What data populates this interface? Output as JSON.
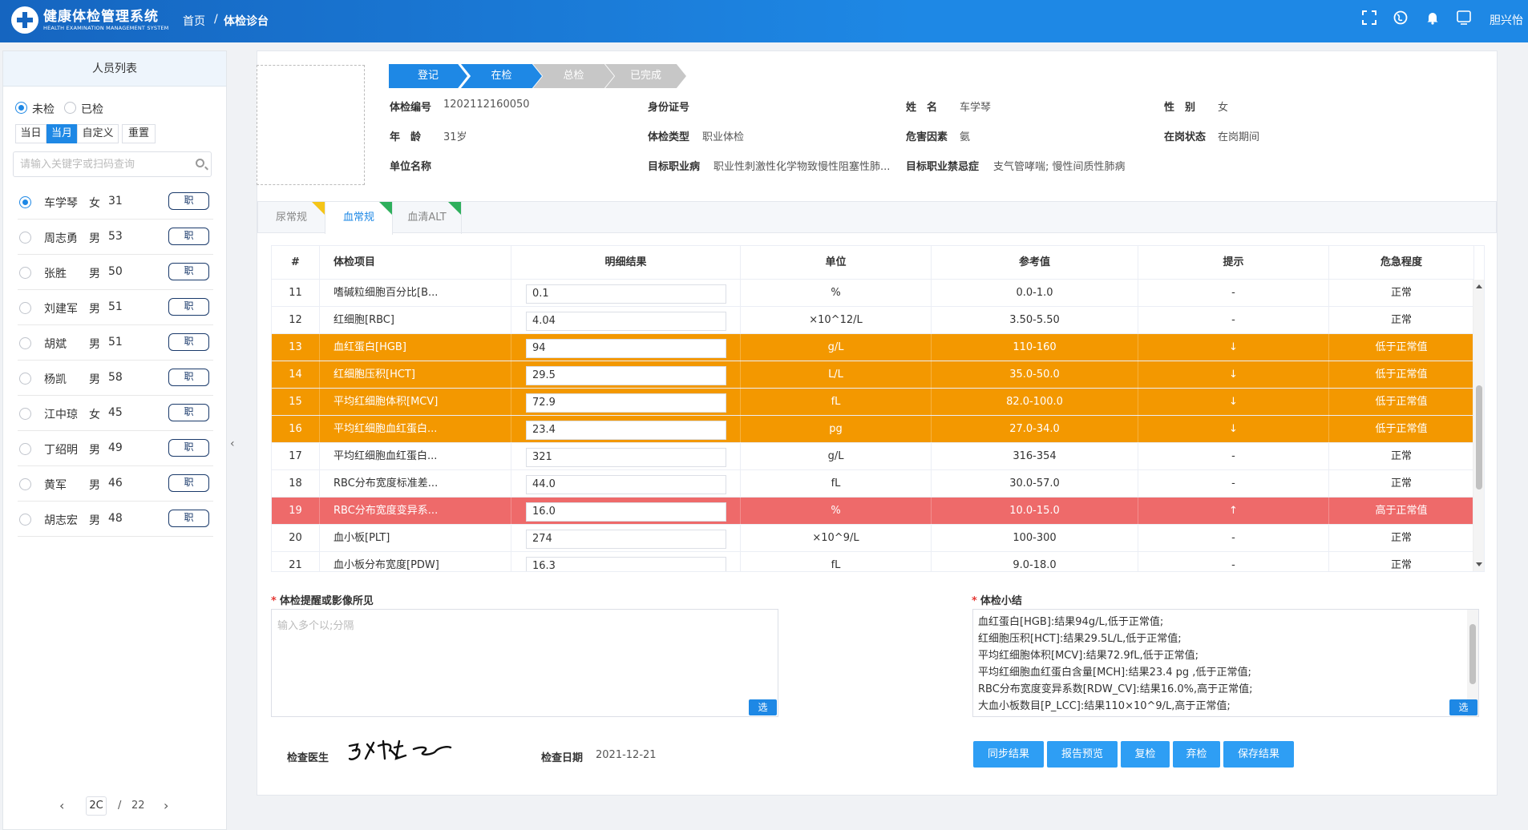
{
  "header": {
    "app_title": "健康体检管理系统",
    "app_subtitle": "HEALTH EXAMINATION MANAGEMENT SYSTEM",
    "breadcrumb": [
      "首页",
      "/",
      "体检诊台"
    ],
    "icons": [
      "fullscreen-icon",
      "globe-icon",
      "bell-icon",
      "monitor-icon"
    ],
    "username": "胆兴怡"
  },
  "left": {
    "title": "人员列表",
    "status_options": [
      {
        "label": "未检",
        "selected": true
      },
      {
        "label": "已检",
        "selected": false
      }
    ],
    "date_filters": [
      {
        "label": "当日",
        "active": false
      },
      {
        "label": "当月",
        "active": true
      },
      {
        "label": "自定义",
        "active": false
      },
      {
        "label": "重置",
        "active": false
      }
    ],
    "search_placeholder": "请输入关键字或扫码查询",
    "people": [
      {
        "name": "车学琴",
        "sex": "女",
        "age": "31",
        "tag": "职",
        "selected": true
      },
      {
        "name": "周志勇",
        "sex": "男",
        "age": "53",
        "tag": "职",
        "selected": false
      },
      {
        "name": "张胜",
        "sex": "男",
        "age": "50",
        "tag": "职",
        "selected": false
      },
      {
        "name": "刘建军",
        "sex": "男",
        "age": "51",
        "tag": "职",
        "selected": false
      },
      {
        "name": "胡斌",
        "sex": "男",
        "age": "51",
        "tag": "职",
        "selected": false
      },
      {
        "name": "杨凯",
        "sex": "男",
        "age": "58",
        "tag": "职",
        "selected": false
      },
      {
        "name": "江中琼",
        "sex": "女",
        "age": "45",
        "tag": "职",
        "selected": false
      },
      {
        "name": "丁绍明",
        "sex": "男",
        "age": "49",
        "tag": "职",
        "selected": false
      },
      {
        "name": "黄军",
        "sex": "男",
        "age": "46",
        "tag": "职",
        "selected": false
      },
      {
        "name": "胡志宏",
        "sex": "男",
        "age": "48",
        "tag": "职",
        "selected": false
      }
    ],
    "pager": {
      "prev": "‹",
      "current": "2C",
      "separator": "/",
      "total": "22",
      "next": "›"
    },
    "collapse": "‹"
  },
  "steps": [
    {
      "label": "登记",
      "done": true
    },
    {
      "label": "在检",
      "done": true
    },
    {
      "label": "总检",
      "done": false
    },
    {
      "label": "已完成",
      "done": false
    }
  ],
  "info": {
    "exam_no_label": "体检编号",
    "exam_no": "1202112160050",
    "id_label": "身份证号",
    "id": "",
    "name_label": "姓　名",
    "name": "车学琴",
    "sex_label": "性　别",
    "sex": "女",
    "age_label": "年　龄",
    "age": "31岁",
    "type_label": "体检类型",
    "type": "职业体检",
    "hazard_label": "危害因素",
    "hazard": "氨",
    "post_label": "在岗状态",
    "post": "在岗期间",
    "unit_label": "单位名称",
    "unit": "",
    "target_disease_label": "目标职业病",
    "target_disease": "职业性刺激性化学物致慢性阻塞性肺...",
    "taboo_label": "目标职业禁忌症",
    "taboo": "支气管哮喘; 慢性间质性肺病"
  },
  "tabs": [
    {
      "label": "尿常规",
      "active": false,
      "corner": "yellow"
    },
    {
      "label": "血常规",
      "active": true,
      "corner": "green"
    },
    {
      "label": "血清ALT",
      "active": false,
      "corner": "green"
    }
  ],
  "table": {
    "headers": [
      "#",
      "体检项目",
      "明细结果",
      "单位",
      "参考值",
      "提示",
      "危急程度"
    ],
    "rows": [
      {
        "no": "11",
        "item": "嗜碱粒细胞百分比[B...",
        "result": "0.1",
        "unit": "%",
        "ref": "0.0-1.0",
        "hint": "-",
        "level": "正常",
        "status": "normal"
      },
      {
        "no": "12",
        "item": "红细胞[RBC]",
        "result": "4.04",
        "unit": "×10^12/L",
        "ref": "3.50-5.50",
        "hint": "-",
        "level": "正常",
        "status": "normal"
      },
      {
        "no": "13",
        "item": "血红蛋白[HGB]",
        "result": "94",
        "unit": "g/L",
        "ref": "110-160",
        "hint": "↓",
        "level": "低于正常值",
        "status": "low"
      },
      {
        "no": "14",
        "item": "红细胞压积[HCT]",
        "result": "29.5",
        "unit": "L/L",
        "ref": "35.0-50.0",
        "hint": "↓",
        "level": "低于正常值",
        "status": "low"
      },
      {
        "no": "15",
        "item": "平均红细胞体积[MCV]",
        "result": "72.9",
        "unit": "fL",
        "ref": "82.0-100.0",
        "hint": "↓",
        "level": "低于正常值",
        "status": "low"
      },
      {
        "no": "16",
        "item": "平均红细胞血红蛋白...",
        "result": "23.4",
        "unit": "pg",
        "ref": "27.0-34.0",
        "hint": "↓",
        "level": "低于正常值",
        "status": "low"
      },
      {
        "no": "17",
        "item": "平均红细胞血红蛋白...",
        "result": "321",
        "unit": "g/L",
        "ref": "316-354",
        "hint": "-",
        "level": "正常",
        "status": "normal"
      },
      {
        "no": "18",
        "item": "RBC分布宽度标准差...",
        "result": "44.0",
        "unit": "fL",
        "ref": "30.0-57.0",
        "hint": "-",
        "level": "正常",
        "status": "normal"
      },
      {
        "no": "19",
        "item": "RBC分布宽度变异系...",
        "result": "16.0",
        "unit": "%",
        "ref": "10.0-15.0",
        "hint": "↑",
        "level": "高于正常值",
        "status": "high"
      },
      {
        "no": "20",
        "item": "血小板[PLT]",
        "result": "274",
        "unit": "×10^9/L",
        "ref": "100-300",
        "hint": "-",
        "level": "正常",
        "status": "normal"
      },
      {
        "no": "21",
        "item": "血小板分布宽度[PDW]",
        "result": "16.3",
        "unit": "fL",
        "ref": "9.0-18.0",
        "hint": "-",
        "level": "正常",
        "status": "normal"
      }
    ]
  },
  "remark": {
    "title": "体检提醒或影像所见",
    "placeholder": "输入多个以;分隔",
    "pick": "选"
  },
  "summary": {
    "title": "体检小结",
    "lines": [
      "血红蛋白[HGB]:结果94g/L,低于正常值;",
      "红细胞压积[HCT]:结果29.5L/L,低于正常值;",
      "平均红细胞体积[MCV]:结果72.9fL,低于正常值;",
      "平均红细胞血红蛋白含量[MCH]:结果23.4 pg ,低于正常值;",
      "RBC分布宽度变异系数[RDW_CV]:结果16.0%,高于正常值;",
      "大血小板数目[P_LCC]:结果110×10^9/L,高于正常值;"
    ],
    "pick": "选"
  },
  "footer": {
    "doctor_label": "检查医生",
    "date_label": "检查日期",
    "date": "2021-12-21",
    "buttons": [
      "同步结果",
      "报告预览",
      "复检",
      "弃检",
      "保存结果"
    ]
  },
  "colors": {
    "primary": "#1e88e5",
    "low": "#f39800",
    "high": "#ee6a6a",
    "step_todo": "#c7c7c7"
  }
}
